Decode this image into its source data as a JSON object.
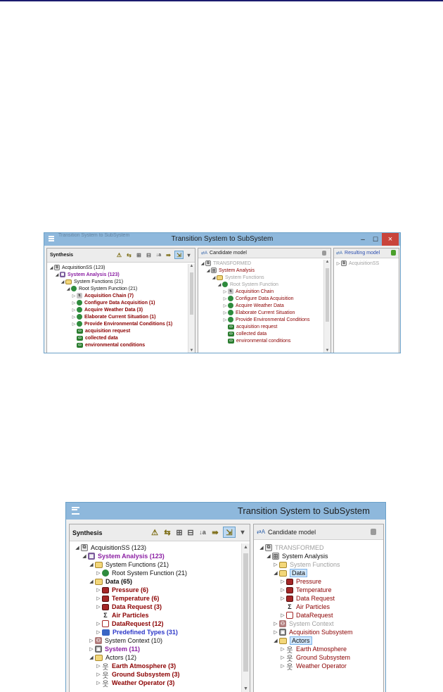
{
  "window": {
    "title": "Transition System to SubSystem",
    "btn_min": "–",
    "btn_max": "☐",
    "btn_close": "×",
    "overlay_label": "Transition System to SubSystem"
  },
  "synthesis": {
    "title": "Synthesis",
    "toolbar": [
      "⚠",
      "⇆",
      "⊞",
      "⊟",
      "↓a",
      "⇛",
      "⇲",
      "▾"
    ]
  },
  "candidate": {
    "title": "Candidate model"
  },
  "resulting": {
    "title": "Resulting model",
    "item": "AcquisitionSS"
  },
  "top_synth_tree": [
    "AcquisitionSS (123)",
    "System Analysis (123)",
    "System Functions (21)",
    "Root System Function (21)",
    "Acquisition Chain (7)",
    "Configure Data Acquisition (1)",
    "Acquire Weather Data (3)",
    "Elaborate Current Situation (1)",
    "Provide Environmental Conditions (1)",
    "acquisition request",
    "collected data",
    "environmental conditions"
  ],
  "top_cand_tree": [
    "TRANSFORMED",
    "System Analysis",
    "System Functions",
    "Root System Function",
    "Acquisition Chain",
    "Configure Data Acquisition",
    "Acquire Weather Data",
    "Elaborate Current Situation",
    "Provide Environmental Conditions",
    "acquisition request",
    "collected data",
    "environmental conditions"
  ],
  "bottom_synth_tree": [
    "AcquisitionSS (123)",
    "System Analysis (123)",
    "System Functions (21)",
    "Root System Function (21)",
    "Data (65)",
    "Pressure (6)",
    "Temperature (6)",
    "Data Request  (3)",
    "Air Particles",
    "DataRequest  (12)",
    "Predefined Types (31)",
    "System Context (10)",
    "System (11)",
    "Actors (12)",
    "Earth Atmosphere (3)",
    "Ground Subsystem (3)",
    "Weather Operator (3)"
  ],
  "bottom_cand_tree": [
    "TRANSFORMED",
    "System Analysis",
    "System Functions",
    "Data",
    "Pressure",
    "Temperature",
    "Data Request",
    "Air Particles",
    "DataRequest",
    "System Context",
    "Acquisition Subsystem",
    "Actors",
    "Earth Atmosphere",
    "Ground Subsystem",
    "Weather Operator"
  ],
  "colors": {
    "titlebar": "#8eb8dc",
    "close": "#c9443b",
    "purple": "#8b1fa3",
    "red": "#8b0000",
    "blue": "#2c37c8"
  }
}
